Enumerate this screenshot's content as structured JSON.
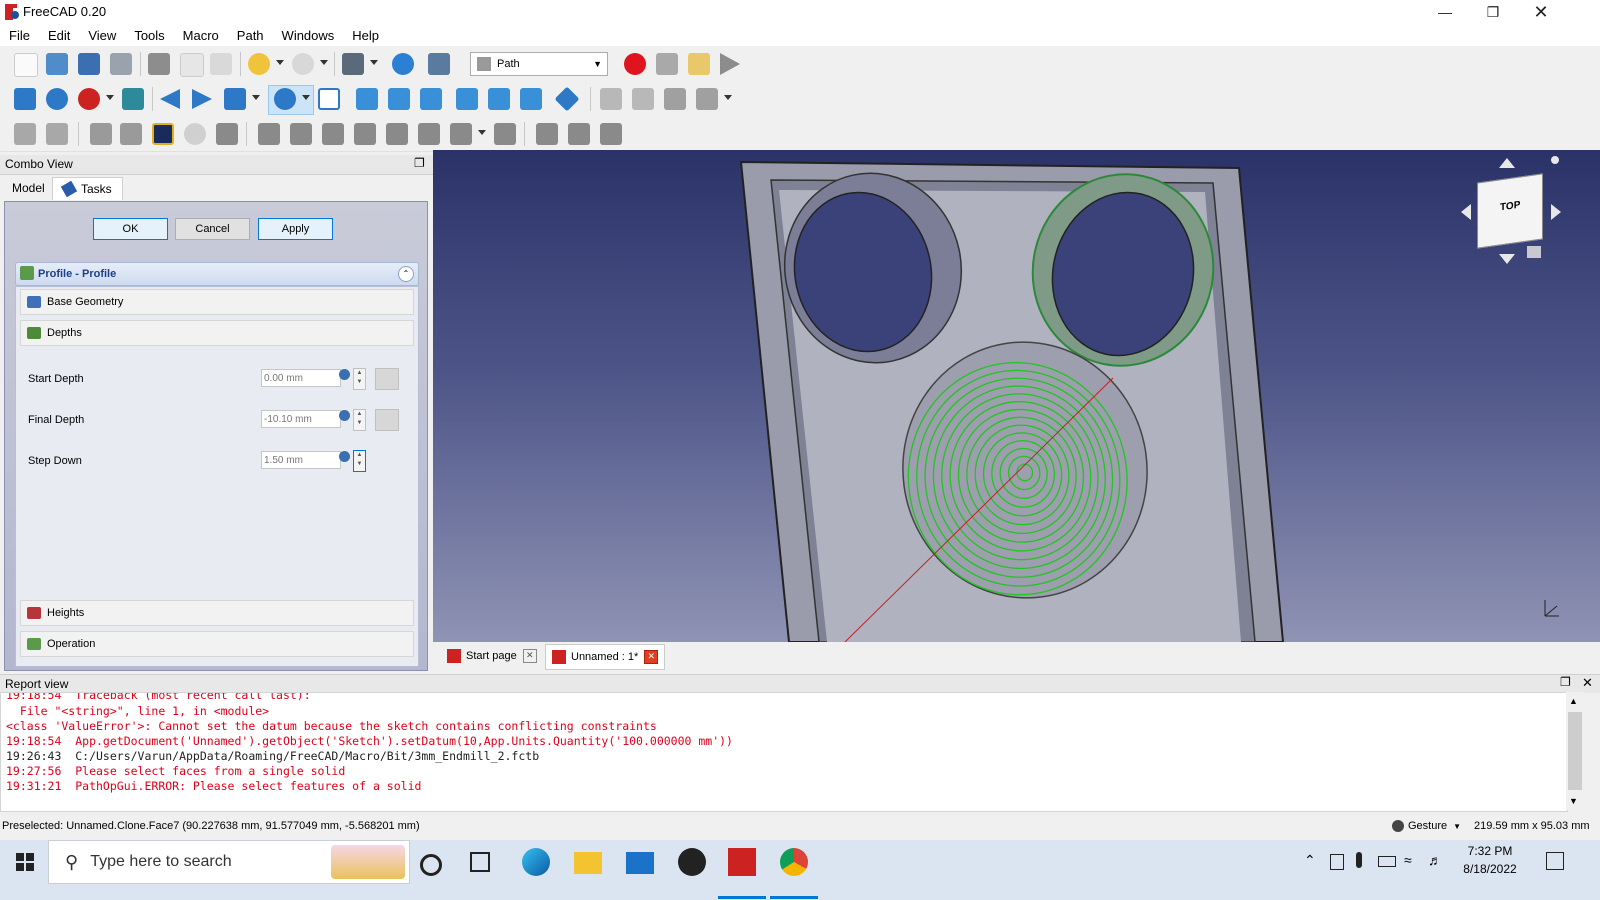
{
  "window": {
    "title": "FreeCAD 0.20"
  },
  "menu": {
    "items": [
      "File",
      "Edit",
      "View",
      "Tools",
      "Macro",
      "Path",
      "Windows",
      "Help"
    ]
  },
  "toolbar": {
    "workbench": "Path"
  },
  "combo": {
    "title": "Combo View",
    "tabs": [
      "Model",
      "Tasks"
    ],
    "buttons": {
      "ok": "OK",
      "cancel": "Cancel",
      "apply": "Apply"
    },
    "task_title": "Profile - Profile",
    "sections": {
      "base_geometry": "Base Geometry",
      "depths": "Depths",
      "heights": "Heights",
      "operation": "Operation"
    },
    "fields": [
      {
        "label": "Start Depth",
        "value": "0.00 mm"
      },
      {
        "label": "Final Depth",
        "value": "-10.10 mm"
      },
      {
        "label": "Step Down",
        "value": "1.50 mm"
      }
    ]
  },
  "nav_cube": {
    "face_label": "TOP"
  },
  "doc_tabs": [
    "Start page",
    "Unnamed : 1*"
  ],
  "report": {
    "title": "Report view",
    "lines": [
      {
        "text": "19:18:54  Traceback (most recent call last):",
        "kind": "error"
      },
      {
        "text": "  File \"<string>\", line 1, in <module>",
        "kind": "error"
      },
      {
        "text": "<class 'ValueError'>: Cannot set the datum because the sketch contains conflicting constraints",
        "kind": "error"
      },
      {
        "text": "19:18:54  App.getDocument('Unnamed').getObject('Sketch').setDatum(10,App.Units.Quantity('100.000000 mm'))",
        "kind": "error"
      },
      {
        "text": "19:26:43  C:/Users/Varun/AppData/Roaming/FreeCAD/Macro/Bit/3mm_Endmill_2.fctb",
        "kind": "log"
      },
      {
        "text": "19:27:56  Please select faces from a single solid",
        "kind": "error"
      },
      {
        "text": "19:31:21  PathOpGui.ERROR: Please select features of a solid",
        "kind": "error"
      }
    ]
  },
  "status": {
    "preselected": "Preselected: Unnamed.Clone.Face7 (90.227638 mm, 91.577049 mm, -5.568201 mm)",
    "navigation": "Gesture",
    "dimensions": "219.59 mm x 95.03 mm"
  },
  "taskbar": {
    "search_placeholder": "Type here to search",
    "time": "7:32 PM",
    "date": "8/18/2022"
  },
  "colors": {
    "toolpath": "#22c522",
    "accent": "#0078d7",
    "error": "#e3001b"
  }
}
